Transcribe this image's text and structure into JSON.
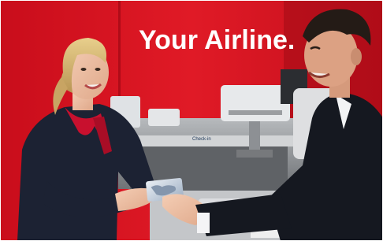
{
  "scene": {
    "wall_sign": "Your Airline.",
    "counter_sign": "Check-in"
  },
  "colors": {
    "wall_red": "#d8121f",
    "uniform_navy": "#1c2233",
    "scarf_red": "#c8102e",
    "counter_gray": "#8c8f93",
    "suit_dark": "#151820"
  }
}
